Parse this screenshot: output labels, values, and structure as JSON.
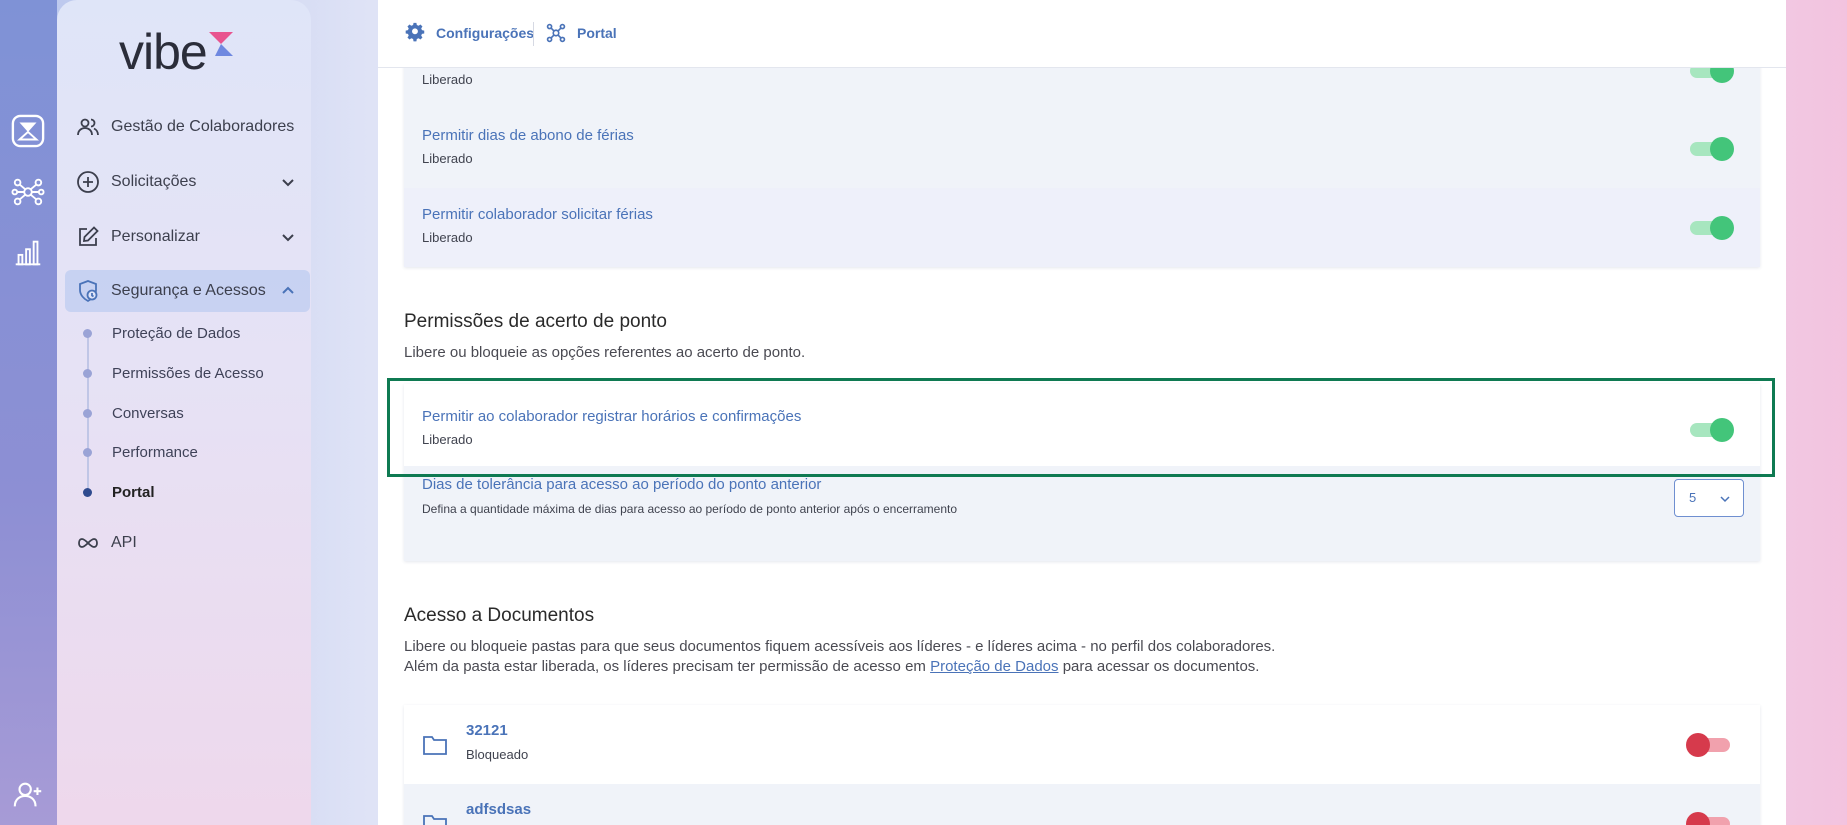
{
  "app": {
    "logo": "vibe"
  },
  "rail": {
    "icons": [
      "hourglass-icon",
      "network-icon",
      "bar-chart-icon",
      "add-user-icon"
    ]
  },
  "sidebar": {
    "items": [
      {
        "label": "Gestão de Colaboradores",
        "icon": "people-icon"
      },
      {
        "label": "Solicitações",
        "icon": "plus-circle-icon"
      },
      {
        "label": "Personalizar",
        "icon": "edit-icon"
      },
      {
        "label": "Segurança e Acessos",
        "icon": "shield-lock-icon"
      },
      {
        "label": "API",
        "icon": "infinity-icon"
      }
    ],
    "subitems": [
      {
        "label": "Proteção de Dados"
      },
      {
        "label": "Permissões de Acesso"
      },
      {
        "label": "Conversas"
      },
      {
        "label": "Performance"
      },
      {
        "label": "Portal"
      }
    ]
  },
  "breadcrumb": {
    "first": "Configurações",
    "second": "Portal"
  },
  "vacation": {
    "rows": [
      {
        "title": "",
        "status": "Liberado"
      },
      {
        "title": "Permitir dias de abono de férias",
        "status": "Liberado"
      },
      {
        "title": "Permitir colaborador solicitar férias",
        "status": "Liberado"
      }
    ]
  },
  "timeclock": {
    "title": "Permissões de acerto de ponto",
    "description": "Libere ou bloqueie as opções referentes ao acerto de ponto.",
    "rows": [
      {
        "title": "Permitir ao colaborador registrar horários e confirmações",
        "status": "Liberado"
      },
      {
        "title": "Dias de tolerância para acesso ao período do ponto anterior",
        "status": "Defina a quantidade máxima de dias para acesso ao período de ponto anterior após o encerramento",
        "select_value": "5"
      }
    ]
  },
  "documents": {
    "title": "Acesso a Documentos",
    "desc_line1": "Libere ou bloqueie pastas para que seus documentos fiquem acessíveis aos líderes - e líderes acima - no perfil dos colaboradores.",
    "desc_line2_pre": "Além da pasta estar liberada, os líderes precisam ter permissão de acesso em",
    "desc_line2_link": "Proteção de Dados",
    "desc_line2_post": "para acessar os documentos.",
    "folders": [
      {
        "name": "32121",
        "status": "Bloqueado"
      },
      {
        "name": "adfsdsas",
        "status": ""
      }
    ]
  }
}
